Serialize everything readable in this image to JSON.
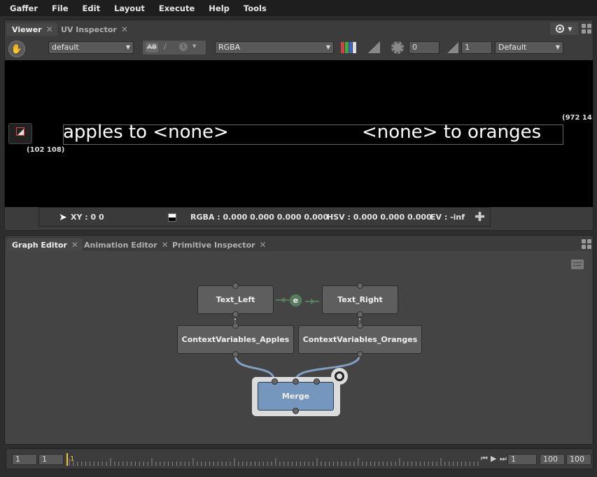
{
  "menubar": [
    "Gaffer",
    "File",
    "Edit",
    "Layout",
    "Execute",
    "Help",
    "Tools"
  ],
  "viewer_panel": {
    "tabs": [
      {
        "label": "Viewer",
        "active": true
      },
      {
        "label": "UV Inspector",
        "active": false
      }
    ],
    "toolbar": {
      "display_transform": "default",
      "channels": "RGBA",
      "exposure": "0",
      "gamma": "1",
      "view": "Default",
      "soloing_glyph": "1"
    },
    "canvas": {
      "text_left": "apples to <none>",
      "text_right": "<none> to oranges",
      "coord_min": "(102 108)",
      "coord_max": "(972 14"
    },
    "status": {
      "xy": "XY : 0 0",
      "rgba": "RGBA : 0.000 0.000 0.000 0.000",
      "hsv": "HSV : 0.000 0.000 0.000",
      "ev": "EV : -inf"
    }
  },
  "graph_panel": {
    "tabs": [
      {
        "label": "Graph Editor",
        "active": true
      },
      {
        "label": "Animation Editor",
        "active": false
      },
      {
        "label": "Primitive Inspector",
        "active": false
      }
    ],
    "nodes": {
      "text_left": "Text_Left",
      "text_right": "Text_Right",
      "ctx_apples": "ContextVariables_Apples",
      "ctx_oranges": "ContextVariables_Oranges",
      "merge": "Merge",
      "expression_badge": "e"
    }
  },
  "timeline": {
    "start_outer": "1",
    "start_inner": "1",
    "current_frame": "1",
    "frame": "1",
    "end_inner": "100",
    "end_outer": "100"
  },
  "colors": {
    "node_selected": "#7596bd",
    "connection": "#7f9fc4",
    "expression": "#5b7b5e"
  }
}
